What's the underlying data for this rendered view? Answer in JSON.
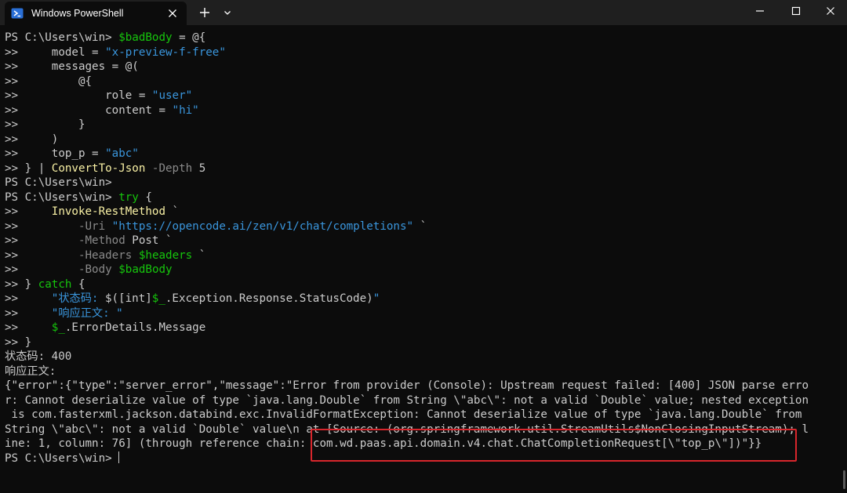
{
  "window": {
    "tab_title": "Windows PowerShell",
    "icons": {
      "tab": "powershell-icon",
      "close_tab": "close-icon",
      "new_tab": "plus-icon",
      "dropdown": "chevron-down-icon",
      "minimize": "minimize-icon",
      "maximize": "maximize-icon",
      "close": "close-icon"
    }
  },
  "colors": {
    "background": "#0c0c0c",
    "titlebar": "#1f1f1f",
    "text": "#cccccc",
    "command": "#f9f1a5",
    "variable": "#16c60c",
    "string": "#3a96dd",
    "parameter": "#8a8a8a",
    "highlight_box": "#d8262c"
  },
  "terminal": {
    "lines": [
      [
        {
          "t": "PS C:\\Users\\win> ",
          "c": "w"
        },
        {
          "t": "$badBody",
          "c": "v"
        },
        {
          "t": " = @{",
          "c": "w"
        }
      ],
      [
        {
          "t": ">>     model = ",
          "c": "w"
        },
        {
          "t": "\"x-preview-f-free\"",
          "c": "s"
        }
      ],
      [
        {
          "t": ">>     messages = @(",
          "c": "w"
        }
      ],
      [
        {
          "t": ">>         @{",
          "c": "w"
        }
      ],
      [
        {
          "t": ">>             role = ",
          "c": "w"
        },
        {
          "t": "\"user\"",
          "c": "s"
        }
      ],
      [
        {
          "t": ">>             content = ",
          "c": "w"
        },
        {
          "t": "\"hi\"",
          "c": "s"
        }
      ],
      [
        {
          "t": ">>         }",
          "c": "w"
        }
      ],
      [
        {
          "t": ">>     )",
          "c": "w"
        }
      ],
      [
        {
          "t": ">>     top_p = ",
          "c": "w"
        },
        {
          "t": "\"abc\"",
          "c": "s"
        }
      ],
      [
        {
          "t": ">> } | ",
          "c": "w"
        },
        {
          "t": "ConvertTo-Json",
          "c": "y"
        },
        {
          "t": " -Depth",
          "c": "g"
        },
        {
          "t": " 5",
          "c": "w"
        }
      ],
      [
        {
          "t": "PS C:\\Users\\win>",
          "c": "w"
        }
      ],
      [
        {
          "t": "PS C:\\Users\\win> ",
          "c": "w"
        },
        {
          "t": "try",
          "c": "v"
        },
        {
          "t": " {",
          "c": "w"
        }
      ],
      [
        {
          "t": ">>     ",
          "c": "w"
        },
        {
          "t": "Invoke-RestMethod",
          "c": "y"
        },
        {
          "t": " `",
          "c": "w"
        }
      ],
      [
        {
          "t": ">>         ",
          "c": "w"
        },
        {
          "t": "-Uri",
          "c": "g"
        },
        {
          "t": " ",
          "c": "w"
        },
        {
          "t": "\"https://opencode.ai/zen/v1/chat/completions\"",
          "c": "s"
        },
        {
          "t": " `",
          "c": "w"
        }
      ],
      [
        {
          "t": ">>         ",
          "c": "w"
        },
        {
          "t": "-Method",
          "c": "g"
        },
        {
          "t": " Post `",
          "c": "w"
        }
      ],
      [
        {
          "t": ">>         ",
          "c": "w"
        },
        {
          "t": "-Headers",
          "c": "g"
        },
        {
          "t": " ",
          "c": "w"
        },
        {
          "t": "$headers",
          "c": "v"
        },
        {
          "t": " `",
          "c": "w"
        }
      ],
      [
        {
          "t": ">>         ",
          "c": "w"
        },
        {
          "t": "-Body",
          "c": "g"
        },
        {
          "t": " ",
          "c": "w"
        },
        {
          "t": "$badBody",
          "c": "v"
        }
      ],
      [
        {
          "t": ">> } ",
          "c": "w"
        },
        {
          "t": "catch",
          "c": "v"
        },
        {
          "t": " {",
          "c": "w"
        }
      ],
      [
        {
          "t": ">>     ",
          "c": "w"
        },
        {
          "t": "\"状态码: ",
          "c": "s"
        },
        {
          "t": "$([int]",
          "c": "w"
        },
        {
          "t": "$_",
          "c": "v"
        },
        {
          "t": ".Exception.Response.StatusCode)",
          "c": "w"
        },
        {
          "t": "\"",
          "c": "s"
        }
      ],
      [
        {
          "t": ">>     ",
          "c": "w"
        },
        {
          "t": "\"响应正文: \"",
          "c": "s"
        }
      ],
      [
        {
          "t": ">>     ",
          "c": "w"
        },
        {
          "t": "$_",
          "c": "v"
        },
        {
          "t": ".ErrorDetails.Message",
          "c": "w"
        }
      ],
      [
        {
          "t": ">> }",
          "c": "w"
        }
      ],
      [
        {
          "t": "状态码: 400",
          "c": "w"
        }
      ],
      [
        {
          "t": "响应正文:",
          "c": "w"
        }
      ],
      [
        {
          "t": "{\"error\":{\"type\":\"server_error\",\"message\":\"Error from provider (Console): Upstream request failed: [400] JSON parse erro",
          "c": "w"
        }
      ],
      [
        {
          "t": "r: Cannot deserialize value of type `java.lang.Double` from String \\\"abc\\\": not a valid `Double` value; nested exception",
          "c": "w"
        }
      ],
      [
        {
          "t": " is com.fasterxml.jackson.databind.exc.InvalidFormatException: Cannot deserialize value of type `java.lang.Double` from",
          "c": "w"
        }
      ],
      [
        {
          "t": "String \\\"abc\\\": not a valid `Double` value\\n at [Source: (org.springframework.util.StreamUtils$NonClosingInputStream); l",
          "c": "w"
        }
      ],
      [
        {
          "t": "ine: 1, column: 76] (through reference chain: com.wd.paas.api.domain.v4.chat.ChatCompletionRequest[\\\"top_p\\\"])\"}}",
          "c": "w"
        }
      ],
      [
        {
          "t": "PS C:\\Users\\win> ",
          "c": "w"
        }
      ]
    ]
  }
}
